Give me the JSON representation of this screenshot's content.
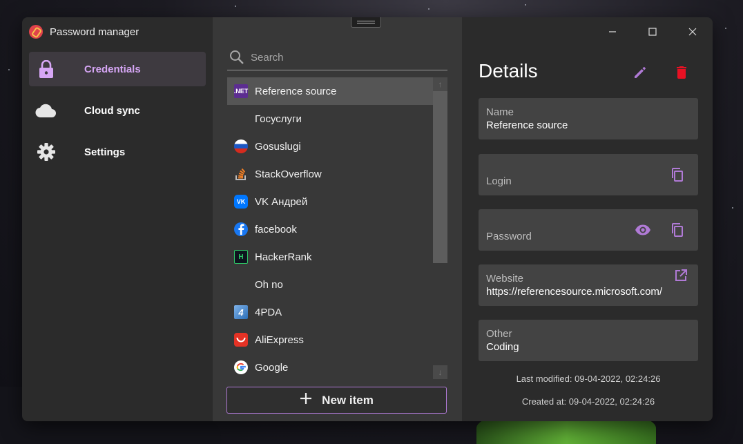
{
  "app": {
    "title": "Password manager"
  },
  "sidebar": {
    "items": [
      {
        "label": "Credentials",
        "icon": "lock-icon",
        "active": true
      },
      {
        "label": "Cloud sync",
        "icon": "cloud-icon",
        "active": false
      },
      {
        "label": "Settings",
        "icon": "gear-icon",
        "active": false
      }
    ]
  },
  "list": {
    "search_placeholder": "Search",
    "items": [
      {
        "label": "Reference source",
        "icon": "dotnet-icon",
        "selected": true
      },
      {
        "label": "Госуслуги",
        "icon": "none"
      },
      {
        "label": "Gosuslugi",
        "icon": "russia-flag-icon"
      },
      {
        "label": "StackOverflow",
        "icon": "stackoverflow-icon"
      },
      {
        "label": "VK Андрей",
        "icon": "vk-icon"
      },
      {
        "label": "facebook",
        "icon": "facebook-icon"
      },
      {
        "label": "HackerRank",
        "icon": "hackerrank-icon"
      },
      {
        "label": "Oh no",
        "icon": "none"
      },
      {
        "label": "4PDA",
        "icon": "4pda-icon"
      },
      {
        "label": "AliExpress",
        "icon": "aliexpress-icon"
      },
      {
        "label": "Google",
        "icon": "google-icon"
      }
    ],
    "new_item_label": "New item",
    "icon_texts": {
      "dotnet": ".NET",
      "vk": "VK",
      "hackerrank": "H",
      "fourpda": "4"
    }
  },
  "details": {
    "title": "Details",
    "name": {
      "label": "Name",
      "value": "Reference source"
    },
    "login": {
      "label": "Login",
      "value": ""
    },
    "password": {
      "label": "Password",
      "value": ""
    },
    "website": {
      "label": "Website",
      "value": "https://referencesource.microsoft.com/"
    },
    "other": {
      "label": "Other",
      "value": "Coding"
    },
    "last_modified": "Last modified: 09-04-2022, 02:24:26",
    "created_at": "Created at: 09-04-2022, 02:24:26"
  },
  "colors": {
    "accent": "#b07ad6",
    "delete": "#e81123",
    "selected_nav_text": "#d6a6f5"
  }
}
